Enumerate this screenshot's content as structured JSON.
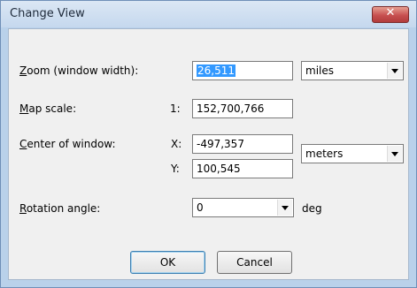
{
  "window": {
    "title": "Change View",
    "close_glyph": "✕"
  },
  "zoom": {
    "label_key": "Z",
    "label_rest": "oom (window width):",
    "value": "26,511",
    "unit": "miles"
  },
  "scale": {
    "label_key": "M",
    "label_rest": "ap scale:",
    "prefix": "1:",
    "value": "152,700,766"
  },
  "center": {
    "label_key": "C",
    "label_rest": "enter of window:",
    "x_label": "X:",
    "x_value": "-497,357",
    "y_label": "Y:",
    "y_value": "100,545",
    "unit": "meters"
  },
  "rotation": {
    "label_key": "R",
    "label_rest": "otation angle:",
    "value": "0",
    "unit": "deg"
  },
  "buttons": {
    "ok": "OK",
    "cancel": "Cancel"
  }
}
